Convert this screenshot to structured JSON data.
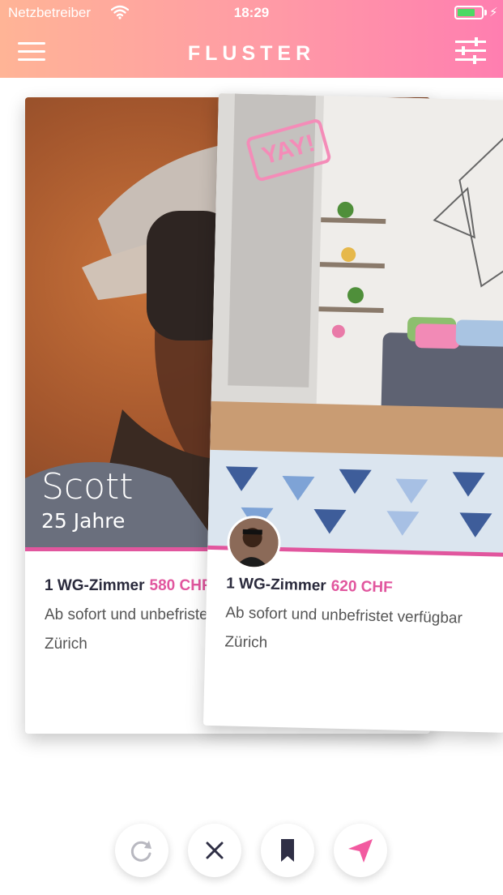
{
  "status_bar": {
    "carrier": "Netzbetreiber",
    "time": "18:29",
    "battery_level": 0.75
  },
  "header": {
    "title": "FLUSTER"
  },
  "cards": [
    {
      "name": "Scott",
      "age": "25 Jahre",
      "room_type": "1 WG-Zimmer",
      "price": "580 CHF",
      "availability": "Ab sofort und unbefristet verfügbar",
      "location": "Zürich"
    },
    {
      "stamp": "YAY!",
      "room_type": "1 WG-Zimmer",
      "price": "620 CHF",
      "availability": "Ab sofort und unbefristet verfügbar",
      "location": "Zürich"
    }
  ],
  "colors": {
    "accent": "#e1569e",
    "header_start": "#ffb496",
    "header_end": "#ff7eb0"
  },
  "actions": [
    "undo-icon",
    "close-icon",
    "bookmark-icon",
    "send-icon"
  ]
}
